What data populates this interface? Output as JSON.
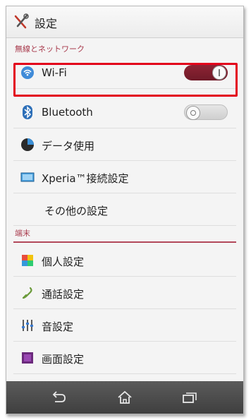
{
  "header": {
    "title": "設定",
    "icon": "settings-tools-icon"
  },
  "sections": {
    "wireless": "無線とネットワーク",
    "device": "端末"
  },
  "wireless_items": [
    {
      "label": "Wi-Fi",
      "icon": "wifi-icon",
      "toggle": "on"
    },
    {
      "label": "Bluetooth",
      "icon": "bluetooth-icon",
      "toggle": "off"
    },
    {
      "label": "データ使用",
      "icon": "data-usage-icon"
    },
    {
      "label": "Xperia™接続設定",
      "icon": "xperia-connect-icon"
    },
    {
      "label": "その他の設定"
    }
  ],
  "device_items": [
    {
      "label": "個人設定",
      "icon": "personalize-icon"
    },
    {
      "label": "通話設定",
      "icon": "call-settings-icon"
    },
    {
      "label": "音設定",
      "icon": "sound-settings-icon"
    },
    {
      "label": "画面設定",
      "icon": "display-settings-icon"
    }
  ],
  "colors": {
    "accent": "#a83a4c",
    "highlight": "#e3001b",
    "toggle_on": "#7c1f2e"
  },
  "navbar": {
    "back": "back-icon",
    "home": "home-icon",
    "recent": "recent-apps-icon"
  }
}
